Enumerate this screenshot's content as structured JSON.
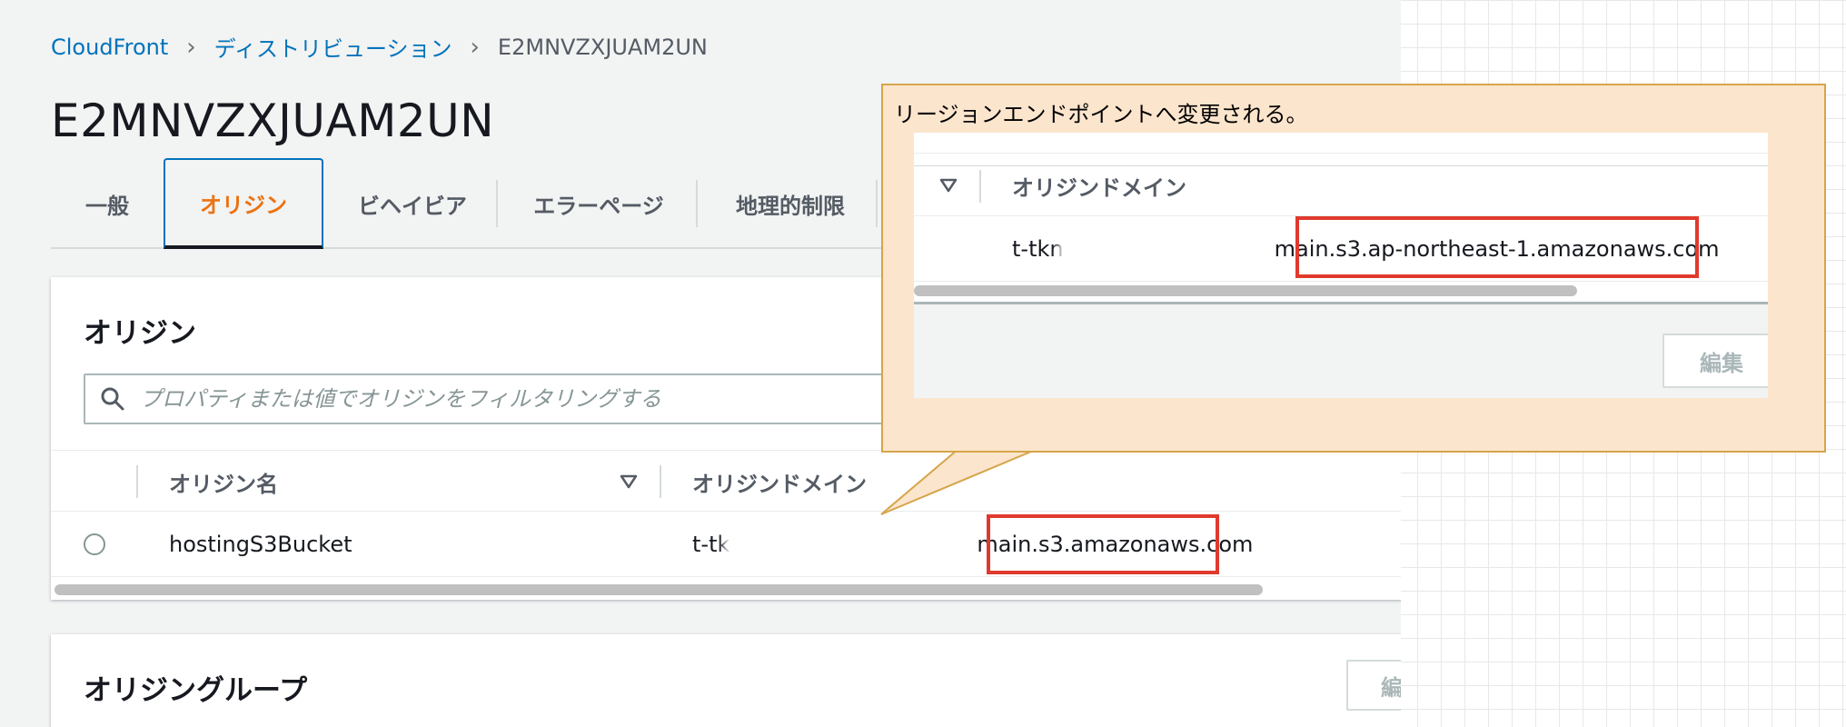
{
  "breadcrumb": {
    "items": [
      "CloudFront",
      "ディストリビューション",
      "E2MNVZXJUAM2UN"
    ]
  },
  "page": {
    "title": "E2MNVZXJUAM2UN"
  },
  "tabs": [
    {
      "label": "一般",
      "active": false
    },
    {
      "label": "オリジン",
      "active": true
    },
    {
      "label": "ビヘイビア",
      "active": false
    },
    {
      "label": "エラーページ",
      "active": false
    },
    {
      "label": "地理的制限",
      "active": false
    }
  ],
  "origins": {
    "title": "オリジン",
    "search_placeholder": "プロパティまたは値でオリジンをフィルタリングする",
    "columns": [
      "オリジン名",
      "オリジンドメイン"
    ],
    "rows": [
      {
        "name": "hostingS3Bucket",
        "domain_prefix": "t-tk",
        "domain_suffix_partial": "ain.s3.amazonaws.com",
        "domain_suffix_lead": "m"
      }
    ]
  },
  "origin_groups": {
    "title": "オリジングループ",
    "edit_label": "編"
  },
  "callout": {
    "text": "リージョンエンドポイントへ変更される。",
    "column_header": "オリジンドメイン",
    "domain_prefix": "t-tkn",
    "domain_suffix": "ain.s3.ap-northeast-1.amazonaws.com",
    "domain_suffix_lead": "m",
    "edit_label": "編集"
  },
  "colors": {
    "link": "#0073bb",
    "active_tab": "#ec7211",
    "highlight": "#e03a2e",
    "callout_bg": "#fce5cd",
    "callout_border": "#d6a54a"
  }
}
